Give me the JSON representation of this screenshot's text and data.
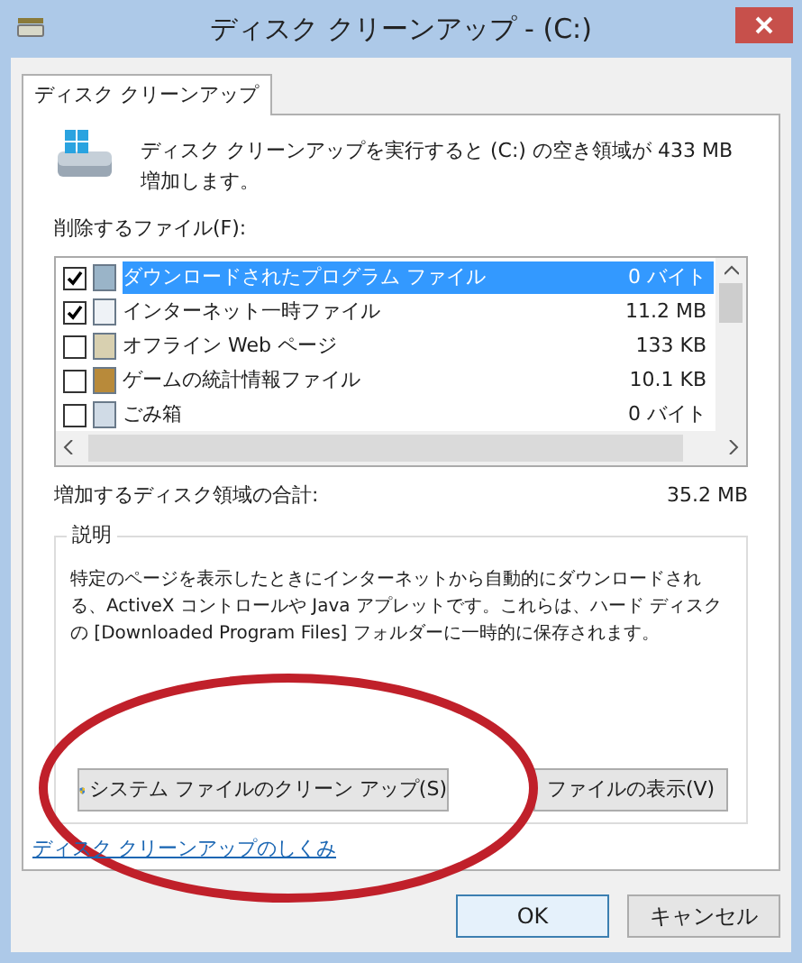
{
  "window": {
    "title": "ディスク クリーンアップ - (C:)"
  },
  "tabs": [
    {
      "label": "ディスク クリーンアップ",
      "selected": true
    }
  ],
  "summary": "ディスク クリーンアップを実行すると (C:) の空き領域が 433 MB 増加します。",
  "files_label": "削除するファイル(F):",
  "files": [
    {
      "name": "ダウンロードされたプログラム ファイル",
      "size": "0 バイト",
      "checked": true,
      "selected": true
    },
    {
      "name": "インターネット一時ファイル",
      "size": "11.2 MB",
      "checked": true,
      "selected": false
    },
    {
      "name": "オフライン Web ページ",
      "size": "133 KB",
      "checked": false,
      "selected": false
    },
    {
      "name": "ゲームの統計情報ファイル",
      "size": "10.1 KB",
      "checked": false,
      "selected": false
    },
    {
      "name": "ごみ箱",
      "size": "0 バイト",
      "checked": false,
      "selected": false
    }
  ],
  "total": {
    "label": "増加するディスク領域の合計:",
    "value": "35.2 MB"
  },
  "description": {
    "title": "説明",
    "text": "特定のページを表示したときにインターネットから自動的にダウンロードされる、ActiveX コントロールや Java アプレットです。これらは、ハード ディスクの [Downloaded Program Files] フォルダーに一時的に保存されます。"
  },
  "system_button": "システム ファイルのクリーン アップ(S)",
  "view_button": "ファイルの表示(V)",
  "help_link": "ディスク クリーンアップのしくみ",
  "buttons": [
    "OK",
    "キャンセル"
  ]
}
